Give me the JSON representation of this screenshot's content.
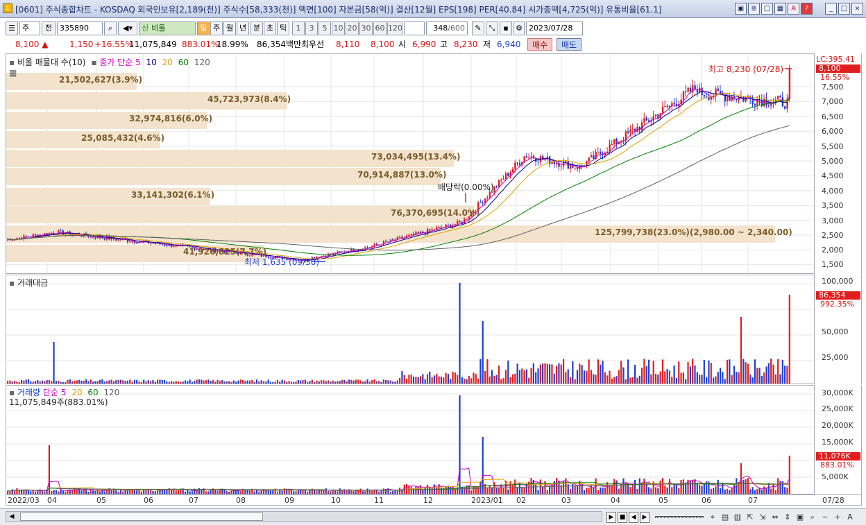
{
  "window": {
    "title": "[0601] 주식종합차트 - KOSDAQ 외국인보유[2,189(천)] 주식수[58,333(천)] 액면[100] 자본금[58(억)] 결산[12월] EPS[198] PER[40.84] 시가총액[4,725(억)] 유통비율[61.1]",
    "app_icon": "1",
    "buttons": [
      "▣",
      "≣",
      "□",
      "▦",
      "A",
      "?",
      "_",
      "□",
      "×"
    ]
  },
  "toolbar": {
    "period_type": "주",
    "prev_label": "전",
    "code": "335890",
    "name": "비올",
    "name_prefix": "신",
    "period_buttons": [
      "일",
      "주",
      "월",
      "년",
      "분",
      "초",
      "틱"
    ],
    "interval_buttons": [
      "1",
      "3",
      "5",
      "10",
      "20",
      "30",
      "60",
      "120"
    ],
    "count": "348",
    "count_total": "/600",
    "date": "2023/07/28"
  },
  "quote": {
    "price": "8,100",
    "arrow": "▲",
    "change": "1,150",
    "change_pct": "+16.55%",
    "volume": "11,075,849",
    "volume_ratio": "883.01%",
    "turnover": "18.99%",
    "amount": "86,354백만",
    "best_label": "최우선",
    "best_ask": "8,110",
    "best_bid": "8,100",
    "open_label": "시",
    "open": "6,990",
    "high_label": "고",
    "high": "8,230",
    "low_label": "저",
    "low": "6,940",
    "buy_label": "매수",
    "sell_label": "매도"
  },
  "price_panel": {
    "legend_title": "비올 매물대 수(10)",
    "ma_title": "종가 단순",
    "ma_periods": [
      "5",
      "10",
      "20",
      "60",
      "120"
    ],
    "ma_colors": [
      "#c800c8",
      "#000080",
      "#e0a000",
      "#008000",
      "#606060"
    ],
    "axis_header": "LC:395.41",
    "axis_price": "8,100",
    "axis_pct": "16.55%",
    "axis_ticks": [
      "7,500",
      "7,000",
      "6,500",
      "6,000",
      "5,500",
      "5,000",
      "4,500",
      "4,000",
      "3,500",
      "3,000",
      "2,500",
      "2,000",
      "1,500"
    ],
    "high_annotation": "최고 8,230 (07/28)",
    "low_annotation": "최저 1,635 (09/30)",
    "dividend_annotation": "배당락(0.00%)",
    "volume_profile": [
      {
        "label": "21,502,627(3.9%)",
        "share": 3.9
      },
      {
        "label": "45,723,973(8.4%)",
        "share": 8.4
      },
      {
        "label": "32,974,816(6.0%)",
        "share": 6.0
      },
      {
        "label": "25,085,432(4.6%)",
        "share": 4.6
      },
      {
        "label": "73,034,495(13.4%)",
        "share": 13.4
      },
      {
        "label": "70,914,887(13.0%)",
        "share": 13.0
      },
      {
        "label": "33,141,302(6.1%)",
        "share": 6.1
      },
      {
        "label": "76,370,695(14.0%)",
        "share": 14.0
      },
      {
        "label": "125,799,738(23.0%)(2,980.00 ~ 2,340.00)",
        "share": 23.0
      },
      {
        "label": "41,926,825(7.7%)",
        "share": 7.7
      }
    ]
  },
  "amount_panel": {
    "legend_title": "거래대금",
    "axis_ticks": [
      "100,000",
      "75,000",
      "50,000",
      "25,000"
    ],
    "axis_value": "86,354",
    "axis_pct": "992.35%"
  },
  "volume_panel": {
    "legend_title": "거래량",
    "ma_title": "단순",
    "ma_periods": [
      "5",
      "20",
      "60",
      "120"
    ],
    "legend_sub": "11,075,849주(883.01%)",
    "axis_ticks": [
      "30,000K",
      "25,000K",
      "20,000K",
      "15,000K",
      "10,000K",
      "5,000K"
    ],
    "axis_value": "11,076K",
    "axis_pct": "883.01%"
  },
  "x_axis": {
    "labels": [
      "2022/03",
      "04",
      "05",
      "06",
      "07",
      "08",
      "09",
      "10",
      "11",
      "12",
      "2023/01",
      "02",
      "03",
      "04",
      "05",
      "06",
      "07"
    ],
    "right_label": "07/28"
  },
  "colors": {
    "up": "#e21d1d",
    "down": "#1c3fd4",
    "profile": "#f3e3cd",
    "grid": "#e6e6e6"
  }
}
